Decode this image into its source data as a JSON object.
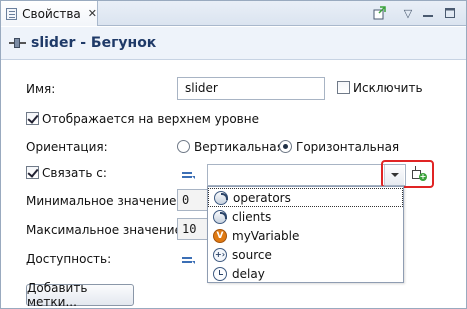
{
  "tab": {
    "label": "Свойства",
    "close": "✕"
  },
  "toolbar": {
    "pin_icon": "pin-icon",
    "minimize": "▽",
    "restore": "□",
    "maximize": "▭"
  },
  "header": {
    "title": "slider - Бегунок",
    "icon": "slider-icon"
  },
  "form": {
    "name_label": "Имя:",
    "name_value": "slider",
    "exclude_label": "Исключить",
    "exclude_checked": false,
    "top_level_label": "Отображается на верхнем уровне",
    "top_level_checked": true,
    "orientation_label": "Ориентация:",
    "orientation_options": [
      "Вертикальная",
      "Горизонтальная"
    ],
    "orientation_selected": "Горизонтальная",
    "link_label": "Связать с:",
    "link_checked": true,
    "link_value": "",
    "min_label": "Минимальное значение:",
    "min_value": "0",
    "max_label": "Максимальное значение:",
    "max_value": "10",
    "availability_label": "Доступность:",
    "add_labels_button": "Добавить метки..."
  },
  "dropdown": {
    "items": [
      {
        "label": "operators",
        "icon": "operator-icon",
        "selected": true
      },
      {
        "label": "clients",
        "icon": "operator-icon",
        "selected": false
      },
      {
        "label": "myVariable",
        "icon": "variable-icon",
        "icon_glyph": "V",
        "selected": false
      },
      {
        "label": "source",
        "icon": "source-icon",
        "icon_glyph": "+›",
        "selected": false
      },
      {
        "label": "delay",
        "icon": "delay-icon",
        "selected": false
      }
    ]
  },
  "colors": {
    "title": "#1f3a68",
    "highlight": "#e02424",
    "link_icon": "#3c6fb5",
    "variable_icon": "#e07a12"
  }
}
